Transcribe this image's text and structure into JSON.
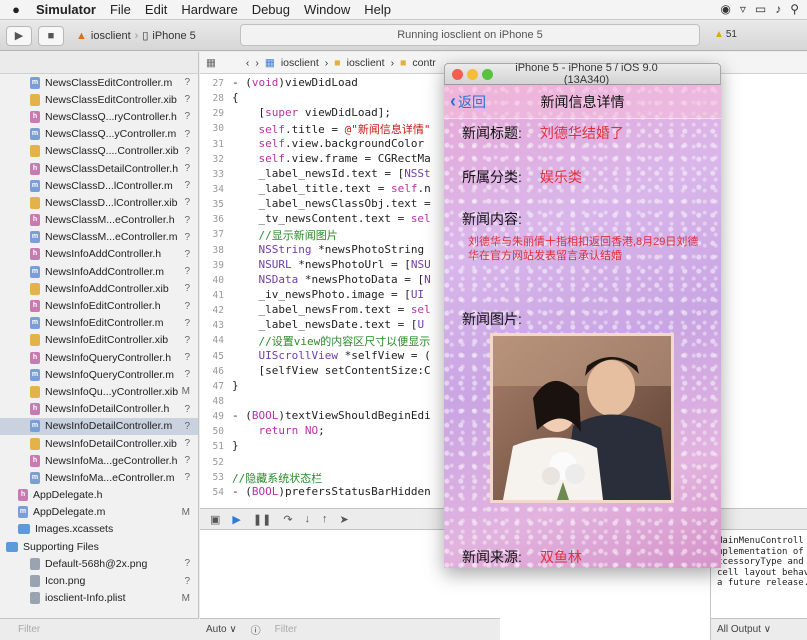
{
  "menubar": {
    "items": [
      "Simulator",
      "File",
      "Edit",
      "Hardware",
      "Debug",
      "Window",
      "Help"
    ]
  },
  "toolbar": {
    "scheme": "iosclient",
    "device": "iPhone 5",
    "activity": "Running iosclient on iPhone 5",
    "warning_count": "51"
  },
  "navigator": {
    "files": [
      {
        "name": "NewsClassEditController.m",
        "status": "?",
        "type": "m"
      },
      {
        "name": "NewsClassEditController.xib",
        "status": "?",
        "type": "x"
      },
      {
        "name": "NewsClassQ...ryController.h",
        "status": "?",
        "type": "h"
      },
      {
        "name": "NewsClassQ...yController.m",
        "status": "?",
        "type": "m"
      },
      {
        "name": "NewsClassQ....Controller.xib",
        "status": "?",
        "type": "x"
      },
      {
        "name": "NewsClassDetailController.h",
        "status": "?",
        "type": "h"
      },
      {
        "name": "NewsClassD...lController.m",
        "status": "?",
        "type": "m"
      },
      {
        "name": "NewsClassD...lController.xib",
        "status": "?",
        "type": "x"
      },
      {
        "name": "NewsClassM...eController.h",
        "status": "?",
        "type": "h"
      },
      {
        "name": "NewsClassM...eController.m",
        "status": "?",
        "type": "m"
      },
      {
        "name": "NewsInfoAddController.h",
        "status": "?",
        "type": "h"
      },
      {
        "name": "NewsInfoAddController.m",
        "status": "?",
        "type": "m"
      },
      {
        "name": "NewsInfoAddController.xib",
        "status": "?",
        "type": "x"
      },
      {
        "name": "NewsInfoEditController.h",
        "status": "?",
        "type": "h"
      },
      {
        "name": "NewsInfoEditController.m",
        "status": "?",
        "type": "m"
      },
      {
        "name": "NewsInfoEditController.xib",
        "status": "?",
        "type": "x"
      },
      {
        "name": "NewsInfoQueryController.h",
        "status": "?",
        "type": "h"
      },
      {
        "name": "NewsInfoQueryController.m",
        "status": "?",
        "type": "m"
      },
      {
        "name": "NewsInfoQu...yController.xib",
        "status": "M",
        "type": "x"
      },
      {
        "name": "NewsInfoDetailController.h",
        "status": "?",
        "type": "h"
      },
      {
        "name": "NewsInfoDetailController.m",
        "status": "?",
        "type": "m",
        "selected": true
      },
      {
        "name": "NewsInfoDetailController.xib",
        "status": "?",
        "type": "x"
      },
      {
        "name": "NewsInfoMa...geController.h",
        "status": "?",
        "type": "h"
      },
      {
        "name": "NewsInfoMa...eController.m",
        "status": "?",
        "type": "m"
      },
      {
        "name": "AppDelegate.h",
        "status": "",
        "type": "h",
        "level": 1
      },
      {
        "name": "AppDelegate.m",
        "status": "M",
        "type": "m",
        "level": 1
      },
      {
        "name": "Images.xcassets",
        "status": "",
        "type": "f",
        "level": 1
      },
      {
        "name": "Supporting Files",
        "status": "",
        "type": "f",
        "level": 0
      },
      {
        "name": "Default-568h@2x.png",
        "status": "?",
        "type": "p"
      },
      {
        "name": "Icon.png",
        "status": "?",
        "type": "p"
      },
      {
        "name": "iosclient-Info.plist",
        "status": "M",
        "type": "p"
      }
    ],
    "filter_placeholder": "Filter"
  },
  "editor": {
    "jumpbar": [
      "iosclient",
      "iosclient",
      "contr"
    ],
    "lines": [
      {
        "n": "27",
        "html": "- (<span class=\"kw\">void</span>)viewDidLoad"
      },
      {
        "n": "28",
        "html": "{"
      },
      {
        "n": "29",
        "html": "    [<span class=\"kw\">super</span> viewDidLoad];"
      },
      {
        "n": "30",
        "html": "    <span class=\"kw\">self</span>.title = <span class=\"str\">@\"新闻信息详情\"</span>"
      },
      {
        "n": "31",
        "html": "    <span class=\"kw\">self</span>.view.backgroundColor                          <span class=\"ty\">mage imageNam</span>"
      },
      {
        "n": "32",
        "html": "    <span class=\"kw\">self</span>.view.frame = CGRectMa                          -45);"
      },
      {
        "n": "33",
        "html": "    _label_newsId.text = [<span class=\"ty\">NSSt</span>                          Info.newsId];"
      },
      {
        "n": "34",
        "html": "    _label_title.text = <span class=\"kw\">self</span>.n"
      },
      {
        "n": "35",
        "html": "    _label_newsClassObj.text =                          ewsInfo.news"
      },
      {
        "n": "36",
        "html": "    _tv_newsContent.text = <span class=\"kw\">sel</span>"
      },
      {
        "n": "37",
        "html": "    <span class=\"cm\">//显示新闻图片</span>"
      },
      {
        "n": "38",
        "html": "    <span class=\"ty\">NSString</span> *newsPhotoString                          elf.newsInfo."
      },
      {
        "n": "39",
        "html": "    <span class=\"ty\">NSURL</span> *newsPhotoUrl = [<span class=\"ty\">NSU</span>"
      },
      {
        "n": "40",
        "html": "    <span class=\"ty\">NSData</span> *newsPhotoData = [<span class=\"ty\">N</span>                          Url];"
      },
      {
        "n": "41",
        "html": "    _iv_newsPhoto.image = [<span class=\"ty\">UI</span>"
      },
      {
        "n": "42",
        "html": "    _label_newsFrom.text = <span class=\"kw\">sel</span>"
      },
      {
        "n": "43",
        "html": "    _label_newsDate.text = [<span class=\"ty\">U</span>                          o.newsDate];"
      },
      {
        "n": "44",
        "html": "    <span class=\"cm\">//设置view的内容区尺寸以便显示</span>"
      },
      {
        "n": "45",
        "html": "    <span class=\"ty\">UIScrollView</span> *selfView = ("
      },
      {
        "n": "46",
        "html": "    [selfView setContentSize:C"
      },
      {
        "n": "47",
        "html": "}"
      },
      {
        "n": "48",
        "html": ""
      },
      {
        "n": "49",
        "html": "- (<span class=\"kw\">BOOL</span>)textViewShouldBeginEdi"
      },
      {
        "n": "50",
        "html": "    <span class=\"kw\">return NO</span>;"
      },
      {
        "n": "51",
        "html": "}"
      },
      {
        "n": "52",
        "html": ""
      },
      {
        "n": "53",
        "html": "<span class=\"cm\">//隐藏系统状态栏</span>"
      },
      {
        "n": "54",
        "html": "- (<span class=\"kw\">BOOL</span>)prefersStatusBarHidden"
      }
    ],
    "output_label": "Auto ∨",
    "console_lines": "MainMenuControll\nmplementation of\nccessoryType and\ncell layout behav\na future release.",
    "console_filter": "All Output ∨",
    "vars_filter": "Filter"
  },
  "simulator": {
    "window_title": "iPhone 5 - iPhone 5 / iOS 9.0 (13A340)",
    "back_label": "返回",
    "nav_title": "新闻信息详情",
    "fields": {
      "title_label": "新闻标题:",
      "title_value": "刘德华结婚了",
      "class_label": "所属分类:",
      "class_value": "娱乐类",
      "content_label": "新闻内容:",
      "content_value": "刘德华与朱丽倩十指相扣返回香港,8月29日刘德华在官方网站发表留言承认结婚",
      "photo_label": "新闻图片:",
      "from_label": "新闻来源:",
      "from_value": "双鱼林"
    }
  }
}
